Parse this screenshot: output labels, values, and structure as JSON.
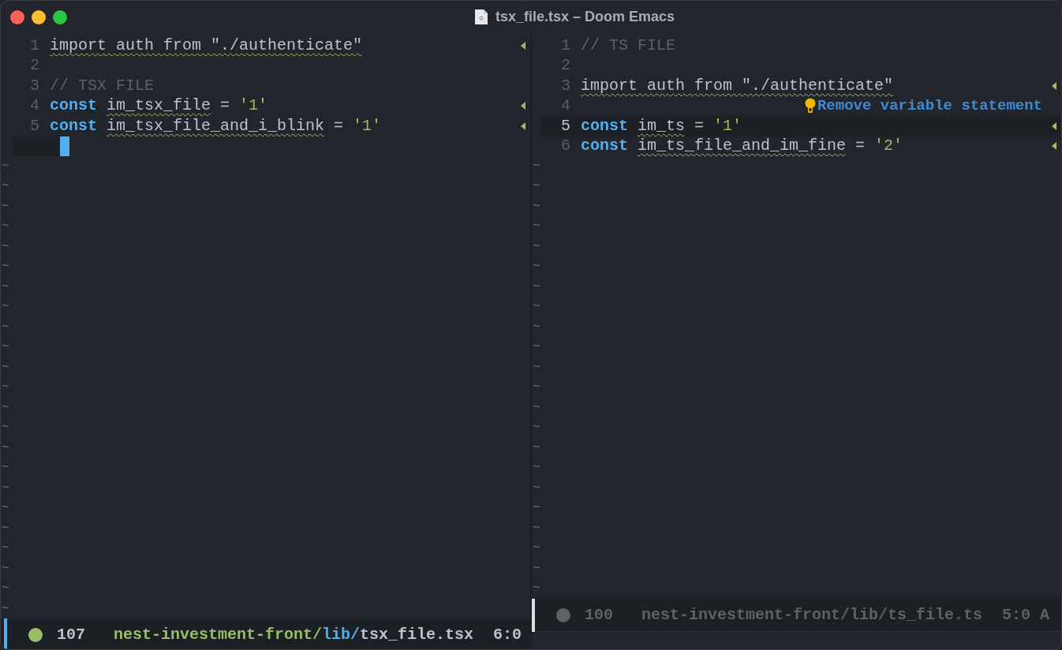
{
  "window": {
    "title": "tsx_file.tsx – Doom Emacs"
  },
  "panes": [
    {
      "active": true,
      "lines": [
        {
          "number": "1",
          "current": false,
          "marker": true,
          "tokens": [
            {
              "kind": "plain",
              "text": "import auth from \"./authenticate\"",
              "flagged": true
            }
          ]
        },
        {
          "number": "2",
          "current": false,
          "marker": false
        },
        {
          "number": "3",
          "current": false,
          "marker": false,
          "tokens": [
            {
              "kind": "comment",
              "text": "// TSX FILE"
            }
          ]
        },
        {
          "number": "4",
          "current": false,
          "marker": true,
          "tokens": [
            {
              "kind": "keyword",
              "text": "const"
            },
            {
              "kind": "plain",
              "text": "im_tsx_file",
              "flagged": true
            },
            {
              "kind": "plain",
              "text": "="
            },
            {
              "kind": "string",
              "text": "'1'"
            }
          ]
        },
        {
          "number": "5",
          "current": false,
          "marker": true,
          "tokens": [
            {
              "kind": "keyword",
              "text": "const"
            },
            {
              "kind": "plain",
              "text": "im_tsx_file_and_i_blink",
              "flagged": true
            },
            {
              "kind": "plain",
              "text": "="
            },
            {
              "kind": "string",
              "text": "'1'"
            }
          ]
        },
        {
          "current": true,
          "cursor": true,
          "marker": false
        }
      ],
      "empty_lines": [
        "~",
        "~",
        "~",
        "~",
        "~",
        "~",
        "~",
        "~",
        "~",
        "~",
        "~",
        "~",
        "~",
        "~",
        "~",
        "~",
        "~",
        "~",
        "~",
        "~",
        "~",
        "~",
        "~"
      ],
      "mode_line": {
        "size": "107",
        "project": "nest-investment-front/",
        "directory": "lib/",
        "file": "tsx_file.tsx",
        "position": "6:0"
      }
    },
    {
      "active": false,
      "lines": [
        {
          "number": "1",
          "current": false,
          "marker": false,
          "tokens": [
            {
              "kind": "comment",
              "text": "// TS FILE"
            }
          ]
        },
        {
          "number": "2",
          "current": false,
          "marker": false
        },
        {
          "number": "3",
          "current": false,
          "marker": true,
          "tokens": [
            {
              "kind": "plain",
              "text": "import auth from \"./authenticate\"",
              "flagged": true
            }
          ]
        },
        {
          "number": "4",
          "current": false,
          "marker": false,
          "hint": "Remove variable statement"
        },
        {
          "number": "5",
          "current": true,
          "marker": true,
          "tokens": [
            {
              "kind": "keyword",
              "text": "const"
            },
            {
              "kind": "plain",
              "text": "im_ts",
              "flagged": true
            },
            {
              "kind": "plain",
              "text": "="
            },
            {
              "kind": "string",
              "text": "'1'"
            }
          ]
        },
        {
          "number": "6",
          "current": false,
          "marker": true,
          "tokens": [
            {
              "kind": "keyword",
              "text": "const"
            },
            {
              "kind": "plain",
              "text": "im_ts_file_and_im_fine",
              "flagged": true
            },
            {
              "kind": "plain",
              "text": "="
            },
            {
              "kind": "string",
              "text": "'2'"
            }
          ]
        }
      ],
      "empty_lines": [
        "~",
        "~",
        "~",
        "~",
        "~",
        "~",
        "~",
        "~",
        "~",
        "~",
        "~",
        "~",
        "~",
        "~",
        "~",
        "~",
        "~",
        "~",
        "~",
        "~",
        "~",
        "~"
      ],
      "mode_line": {
        "size": "100",
        "project": "nest-investment-front/",
        "directory": "lib/",
        "file": "ts_file.ts",
        "position": "5:0 A"
      }
    }
  ]
}
